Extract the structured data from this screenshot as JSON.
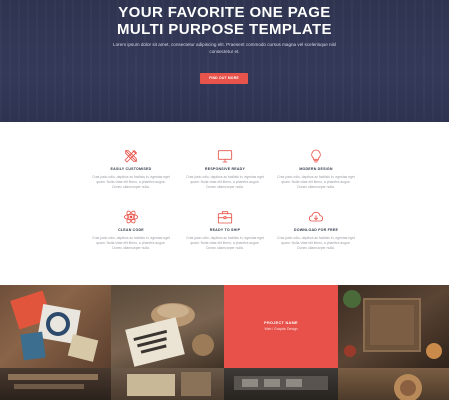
{
  "hero": {
    "title_line1": "YOUR FAVORITE ONE PAGE",
    "title_line2": "MULTI PURPOSE TEMPLATE",
    "subtitle": "Lorem ipsum dolor sit amet, consectetur adipiscing elit. Praesent commodo cursus magna vel scelerisque nisl consectetur et.",
    "button_label": "FIND OUT MORE",
    "accent": "#e8544c",
    "background": "#2f3550"
  },
  "features": [
    {
      "icon": "pencil-ruler-icon",
      "title": "EASILY CUSTOMISED",
      "desc": "Cras justo odio, dapibus ac facilisis in, egestas eget quam. Nulla vitae elit libero, a pharetra augue. Donec ullamcorper nulla."
    },
    {
      "icon": "monitor-icon",
      "title": "RESPONSIVE READY",
      "desc": "Cras justo odio, dapibus ac facilisis in, egestas eget quam. Nulla vitae elit libero, a pharetra augue. Donec ullamcorper nulla."
    },
    {
      "icon": "lightbulb-icon",
      "title": "MODERN DESIGN",
      "desc": "Cras justo odio, dapibus ac facilisis in, egestas eget quam. Nulla vitae elit libero, a pharetra augue. Donec ullamcorper nulla."
    },
    {
      "icon": "atom-icon",
      "title": "CLEAN CODE",
      "desc": "Cras justo odio, dapibus ac facilisis in, egestas eget quam. Nulla vitae elit libero, a pharetra augue. Donec ullamcorper nulla."
    },
    {
      "icon": "briefcase-icon",
      "title": "READY TO SHIP",
      "desc": "Cras justo odio, dapibus ac facilisis in, egestas eget quam. Nulla vitae elit libero, a pharetra augue. Donec ullamcorper nulla."
    },
    {
      "icon": "cloud-download-icon",
      "title": "DOWNLOAD FOR FREE",
      "desc": "Cras justo odio, dapibus ac facilisis in, egestas eget quam. Nulla vitae elit libero, a pharetra augue. Donec ullamcorper nulla."
    }
  ],
  "portfolio": {
    "overlay": {
      "project_name": "PROJECT NAME",
      "category": "Web / Graphic Design"
    },
    "accent": "#e8514a"
  }
}
